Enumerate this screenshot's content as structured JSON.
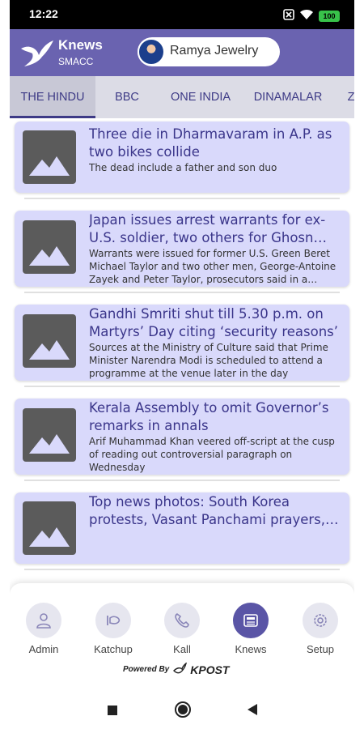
{
  "status_bar": {
    "time": "12:22",
    "battery": "100",
    "icons": [
      "close-box-icon",
      "wifi-icon",
      "battery-icon"
    ]
  },
  "header": {
    "brand_name": "Knews",
    "brand_sub": "SMACC",
    "user_name": "Ramya Jewelry",
    "color": "#6a63b0"
  },
  "tabs": [
    {
      "label": "THE HINDU",
      "active": true
    },
    {
      "label": "BBC",
      "active": false
    },
    {
      "label": "ONE INDIA",
      "active": false
    },
    {
      "label": "DINAMALAR",
      "active": false
    },
    {
      "label": "Z",
      "active": false
    }
  ],
  "news": [
    {
      "title": "Three die in Dharmavaram in A.P. as two bikes collide",
      "desc": "The dead include a father and son duo"
    },
    {
      "title": "Japan issues arrest warrants for ex-U.S. soldier, two others for Ghosn escape",
      "desc": "Warrants were issued for former U.S. Green Beret Michael Taylor and two other men, George-Antoine Zayek and Peter Taylor, prosecutors said in a statement"
    },
    {
      "title": "Gandhi Smriti shut till 5.30 p.m. on Martyrs’ Day citing ‘security reasons’",
      "desc": "Sources at the Ministry of Culture said that Prime Minister Narendra Modi is scheduled to attend a programme at the venue later in the day"
    },
    {
      "title": "Kerala Assembly to omit Governor’s remarks in annals",
      "desc": "Arif Muhammad Khan veered off-script at the cusp of reading out controversial paragraph on Wednesday"
    },
    {
      "title": "Top news photos: South Korea protests, Vasant Panchami prayers, and more",
      "desc": ""
    }
  ],
  "bottom_nav": [
    {
      "label": "Admin",
      "icon": "admin-icon",
      "active": false
    },
    {
      "label": "Katchup",
      "icon": "katchup-icon",
      "active": false
    },
    {
      "label": "Kall",
      "icon": "phone-icon",
      "active": false
    },
    {
      "label": "Knews",
      "icon": "newspaper-icon",
      "active": true
    },
    {
      "label": "Setup",
      "icon": "settings-icon",
      "active": false
    }
  ],
  "powered": {
    "text": "Powered By",
    "brand": "KPOST"
  },
  "colors": {
    "accent": "#6a63b0",
    "card": "#d9d9fb",
    "title": "#3a358a",
    "tab_text": "#3d3a86"
  }
}
